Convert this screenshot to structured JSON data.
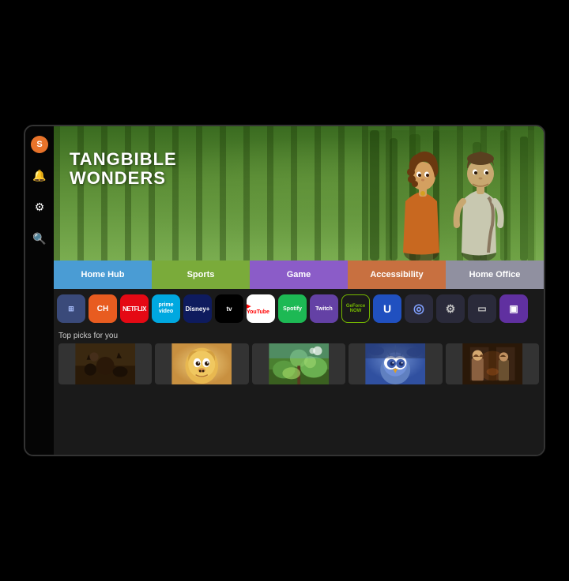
{
  "tv": {
    "hero": {
      "title_line1": "TANGBIBLE",
      "title_line2": "WONDERS"
    },
    "nav_tabs": [
      {
        "id": "home-hub",
        "label": "Home Hub",
        "class": "tab-home-hub"
      },
      {
        "id": "sports",
        "label": "Sports",
        "class": "tab-sports"
      },
      {
        "id": "game",
        "label": "Game",
        "class": "tab-game"
      },
      {
        "id": "accessibility",
        "label": "Accessibility",
        "class": "tab-accessibility"
      },
      {
        "id": "home-office",
        "label": "Home Office",
        "class": "tab-home-office"
      }
    ],
    "apps": [
      {
        "id": "all-apps",
        "label": "⊞",
        "class": "app-all"
      },
      {
        "id": "ch",
        "label": "CH",
        "class": "app-ch"
      },
      {
        "id": "netflix",
        "label": "NETFLIX",
        "class": "app-netflix"
      },
      {
        "id": "prime-video",
        "label": "prime video",
        "class": "app-prime"
      },
      {
        "id": "disney-plus",
        "label": "Disney+",
        "class": "app-disney"
      },
      {
        "id": "apple-tv",
        "label": "tv",
        "class": "app-appletv"
      },
      {
        "id": "youtube",
        "label": "▶ YouTube",
        "class": "app-youtube"
      },
      {
        "id": "spotify",
        "label": "Spotify",
        "class": "app-spotify"
      },
      {
        "id": "twitch",
        "label": "Twitch",
        "class": "app-twitch"
      },
      {
        "id": "geforce-now",
        "label": "GeForce NOW",
        "class": "app-geforce"
      },
      {
        "id": "u-app",
        "label": "U",
        "class": "app-u"
      },
      {
        "id": "circle-app",
        "label": "◎",
        "class": "app-circle"
      },
      {
        "id": "settings-app",
        "label": "⚙",
        "class": "app-settings"
      },
      {
        "id": "monitor-app",
        "label": "▭",
        "class": "app-monitor"
      },
      {
        "id": "purple-app",
        "label": "▣",
        "class": "app-purple"
      }
    ],
    "picks": {
      "label": "Top picks for you",
      "items": [
        {
          "id": "pick-1",
          "class": "thumb-1"
        },
        {
          "id": "pick-2",
          "class": "thumb-2"
        },
        {
          "id": "pick-3",
          "class": "thumb-3"
        },
        {
          "id": "pick-4",
          "class": "thumb-4"
        },
        {
          "id": "pick-5",
          "class": "thumb-5"
        }
      ]
    },
    "sidebar": {
      "user_initial": "S",
      "icons": [
        {
          "id": "bell",
          "symbol": "🔔"
        },
        {
          "id": "settings",
          "symbol": "⚙"
        },
        {
          "id": "search",
          "symbol": "🔍"
        }
      ]
    }
  }
}
